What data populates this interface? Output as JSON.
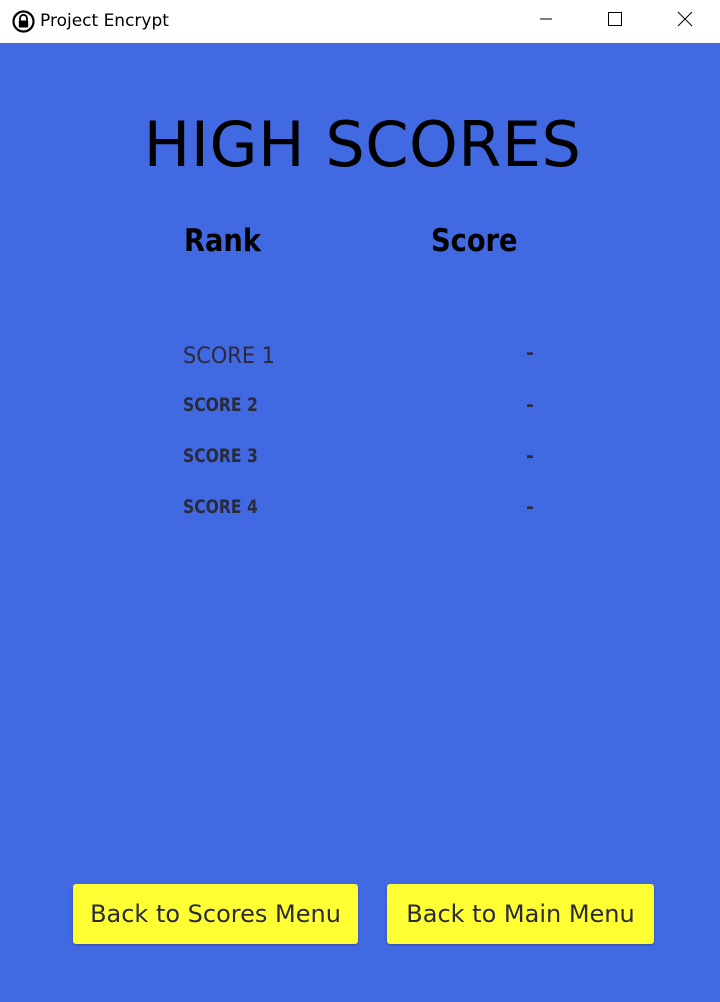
{
  "window": {
    "title": "Project Encrypt",
    "icon": "lock-icon",
    "controls": [
      "minimize-icon",
      "maximize-icon",
      "close-icon"
    ]
  },
  "screen": {
    "heading": "HIGH SCORES",
    "columns": {
      "rank": "Rank",
      "score": "Score"
    },
    "rows": [
      {
        "label": "SCORE 1",
        "value": "-"
      },
      {
        "label": "SCORE 2",
        "value": "-"
      },
      {
        "label": "SCORE 3",
        "value": "-"
      },
      {
        "label": "SCORE 4",
        "value": "-"
      }
    ]
  },
  "buttons": {
    "back_scores": "Back to Scores Menu",
    "back_main": "Back to Main Menu"
  },
  "colors": {
    "background": "#4169E1",
    "button": "#FFFF33",
    "titlebar": "#FFFFFF"
  }
}
